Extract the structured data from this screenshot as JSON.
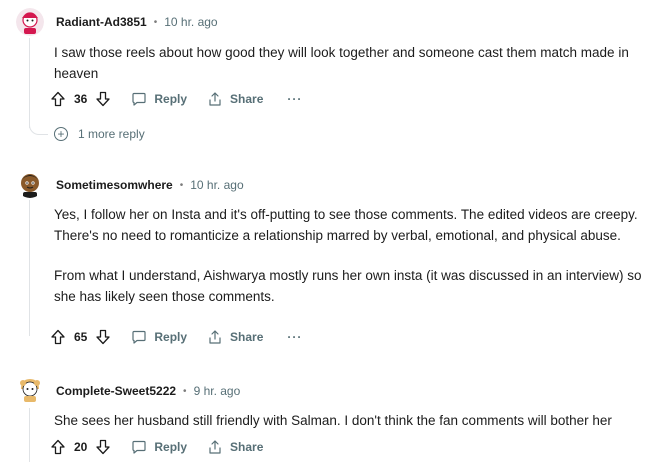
{
  "comments": [
    {
      "author": "Radiant-Ad3851",
      "time": "10 hr. ago",
      "paragraphs": [
        "I saw those reels about how good they will look together and someone cast them match made in heaven"
      ],
      "votes": "36",
      "reply_label": "Reply",
      "share_label": "Share",
      "more_label": "···",
      "more_replies": "1 more reply"
    },
    {
      "author": "Sometimesomwhere",
      "time": "10 hr. ago",
      "paragraphs": [
        "Yes, I follow her on Insta and it's off-putting to see those comments. The edited videos are creepy. There's no need to romanticize a relationship marred by verbal, emotional, and physical abuse.",
        "From what I understand, Aishwarya mostly runs her own insta (it was discussed in an interview) so she has likely seen those comments."
      ],
      "votes": "65",
      "reply_label": "Reply",
      "share_label": "Share",
      "more_label": "···"
    },
    {
      "author": "Complete-Sweet5222",
      "time": "9 hr. ago",
      "paragraphs": [
        "She sees her husband still friendly with Salman. I don't think the fan comments will bother her"
      ],
      "votes": "20",
      "reply_label": "Reply",
      "share_label": "Share"
    }
  ],
  "separator": "•",
  "colors": {
    "text": "#1c1c1c",
    "meta": "#576f76",
    "thread": "#e0e3e6"
  }
}
